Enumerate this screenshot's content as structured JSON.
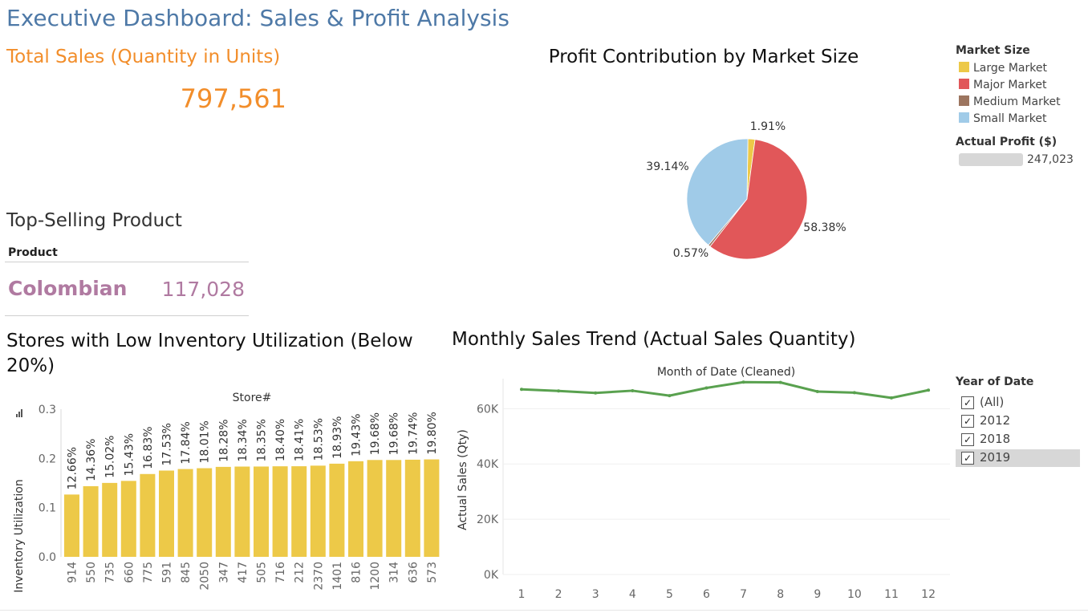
{
  "header": {
    "title": "Executive Dashboard: Sales & Profit Analysis"
  },
  "total_sales": {
    "title": "Total Sales (Quantity in Units)",
    "value": "797,561"
  },
  "top_product": {
    "title": "Top-Selling Product",
    "column_header": "Product",
    "name": "Colombian",
    "value": "117,028"
  },
  "pie": {
    "title": "Profit Contribution by Market Size",
    "legend_title": "Market Size",
    "legend": [
      {
        "label": "Large Market",
        "color": "#edc948"
      },
      {
        "label": "Major Market",
        "color": "#e15759"
      },
      {
        "label": "Medium Market",
        "color": "#9c755f"
      },
      {
        "label": "Small Market",
        "color": "#a0cbe8"
      }
    ],
    "size_legend_title": "Actual Profit ($)",
    "size_legend_value": "247,023"
  },
  "bar": {
    "title": "Stores with Low Inventory Utilization (Below 20%)"
  },
  "line": {
    "title": "Monthly Sales Trend (Actual Sales Quantity)"
  },
  "year_filter": {
    "title": "Year of Date",
    "options": [
      {
        "label": "(All)",
        "checked": true
      },
      {
        "label": "2012",
        "checked": true
      },
      {
        "label": "2018",
        "checked": true
      },
      {
        "label": "2019",
        "checked": true
      }
    ],
    "check_mark": "✓"
  },
  "chart_data": [
    {
      "type": "pie",
      "title": "Profit Contribution by Market Size",
      "categories": [
        "Large Market",
        "Major Market",
        "Medium Market",
        "Small Market"
      ],
      "values": [
        1.91,
        58.38,
        0.57,
        39.14
      ],
      "labels": [
        "1.91%",
        "58.38%",
        "0.57%",
        "39.14%"
      ],
      "colors": [
        "#edc948",
        "#e15759",
        "#9c755f",
        "#a0cbe8"
      ],
      "legend": "right"
    },
    {
      "type": "bar",
      "title": "Stores with Low Inventory Utilization (Below 20%)",
      "xlabel": "Store#",
      "ylabel": "Inventory Utilization",
      "categories": [
        "914",
        "550",
        "735",
        "660",
        "775",
        "591",
        "845",
        "2050",
        "347",
        "417",
        "505",
        "716",
        "212",
        "2370",
        "1401",
        "816",
        "1200",
        "314",
        "636",
        "573"
      ],
      "values": [
        0.1266,
        0.1436,
        0.1502,
        0.1543,
        0.1683,
        0.1753,
        0.1784,
        0.1801,
        0.1828,
        0.1834,
        0.1835,
        0.184,
        0.1841,
        0.1853,
        0.1893,
        0.1943,
        0.1968,
        0.1968,
        0.1974,
        0.198
      ],
      "labels": [
        "12.66%",
        "14.36%",
        "15.02%",
        "15.43%",
        "16.83%",
        "17.53%",
        "17.84%",
        "18.01%",
        "18.28%",
        "18.34%",
        "18.35%",
        "18.40%",
        "18.41%",
        "18.53%",
        "18.93%",
        "19.43%",
        "19.68%",
        "19.68%",
        "19.74%",
        "19.80%"
      ],
      "ylim": [
        0,
        0.3
      ],
      "yticks": [
        "0.0",
        "0.1",
        "0.2",
        "0.3"
      ],
      "color": "#edc948"
    },
    {
      "type": "line",
      "title": "Monthly Sales Trend (Actual Sales Quantity)",
      "xlabel": "Month of Date (Cleaned)",
      "ylabel": "Actual Sales (Qty)",
      "x": [
        1,
        2,
        3,
        4,
        5,
        6,
        7,
        8,
        9,
        10,
        11,
        12
      ],
      "values": [
        67000,
        66400,
        65700,
        66500,
        64700,
        67500,
        69600,
        69500,
        66200,
        65800,
        63900,
        66700
      ],
      "ylim": [
        0,
        72000
      ],
      "yticks": [
        "0K",
        "20K",
        "40K",
        "60K"
      ],
      "color": "#59a14f",
      "grid": true
    }
  ]
}
